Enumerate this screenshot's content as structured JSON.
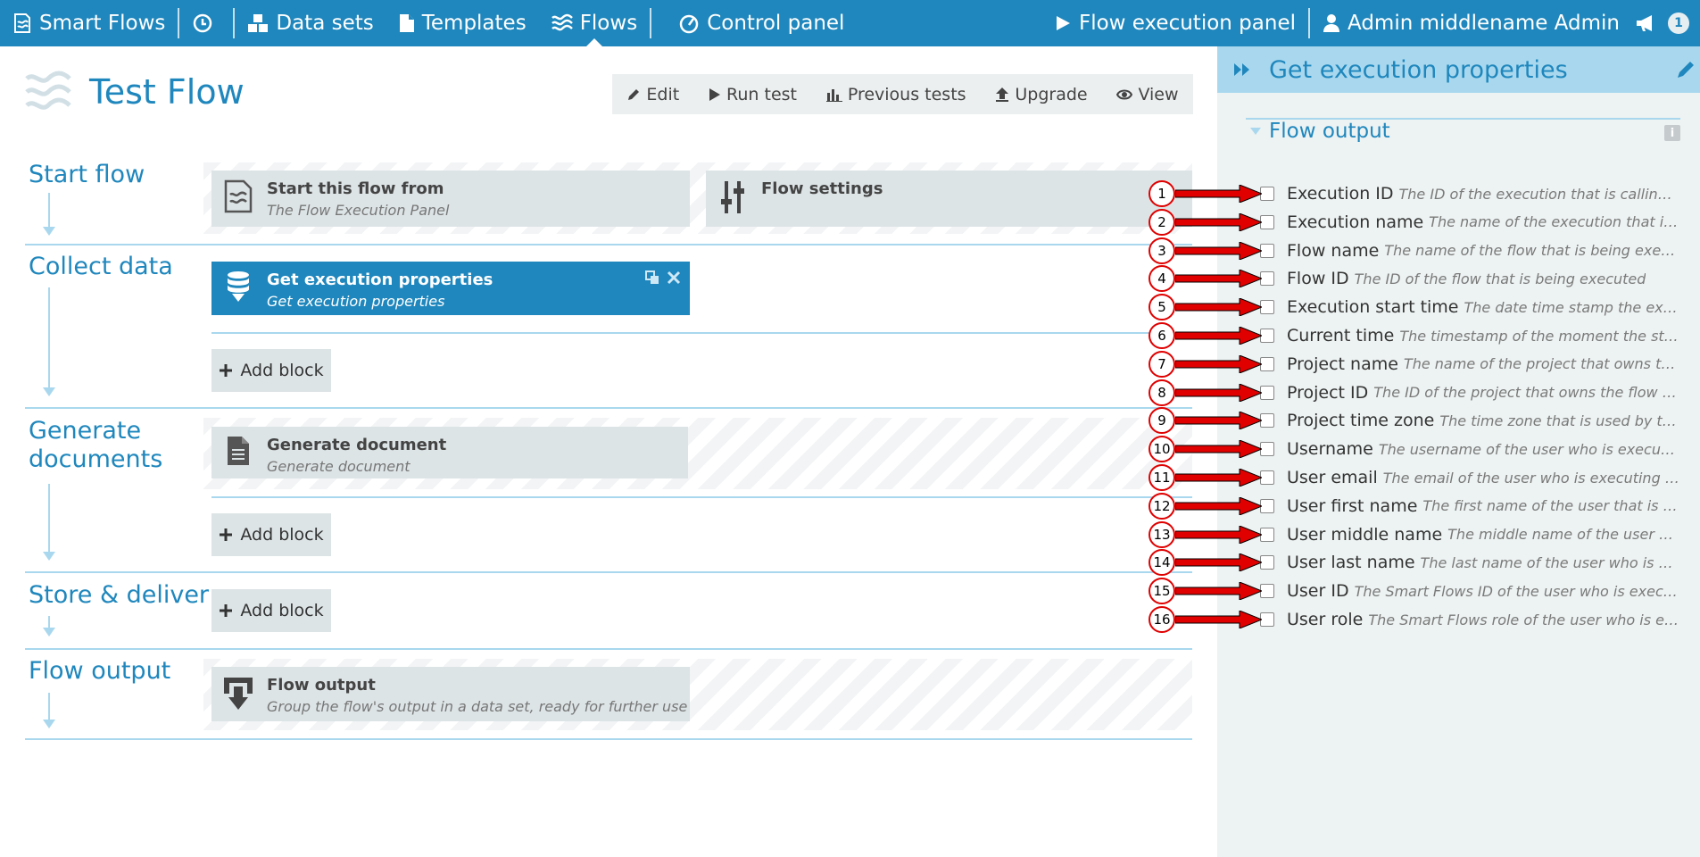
{
  "nav": {
    "brand": "Smart Flows",
    "datasets": "Data sets",
    "templates": "Templates",
    "flows": "Flows",
    "control_panel": "Control panel",
    "flow_execution_panel": "Flow execution panel",
    "user": "Admin middlename Admin",
    "notification_count": "1"
  },
  "page": {
    "title": "Test Flow"
  },
  "toolbar": {
    "edit": "Edit",
    "run_test": "Run test",
    "previous_tests": "Previous tests",
    "upgrade": "Upgrade",
    "view": "View"
  },
  "sections": {
    "start": "Start flow",
    "collect": "Collect data",
    "generate_1": "Generate",
    "generate_2": "documents",
    "store": "Store & deliver",
    "output": "Flow output"
  },
  "blocks": {
    "start_title": "Start this flow from",
    "start_sub": "The Flow Execution Panel",
    "settings_title": "Flow settings",
    "exec_title": "Get execution properties",
    "exec_sub": "Get execution properties",
    "gen_title": "Generate document",
    "gen_sub": "Generate document",
    "out_title": "Flow output",
    "out_sub": "Group the flow's output in a data set, ready for further use",
    "add_block": "Add block"
  },
  "panel": {
    "title": "Get execution properties",
    "section_title": "Flow output",
    "properties": [
      {
        "num": "1",
        "name": "Execution ID",
        "desc": "The ID of the execution that is calling th..."
      },
      {
        "num": "2",
        "name": "Execution name",
        "desc": "The name of the execution that is c..."
      },
      {
        "num": "3",
        "name": "Flow name",
        "desc": "The name of the flow that is being execut..."
      },
      {
        "num": "4",
        "name": "Flow ID",
        "desc": "The ID of the flow that is being executed"
      },
      {
        "num": "5",
        "name": "Execution start time",
        "desc": "The date time stamp the execut..."
      },
      {
        "num": "6",
        "name": "Current time",
        "desc": "The timestamp of the moment the step ..."
      },
      {
        "num": "7",
        "name": "Project name",
        "desc": "The name of the project that owns the ..."
      },
      {
        "num": "8",
        "name": "Project ID",
        "desc": "The ID of the project that owns the flow th..."
      },
      {
        "num": "9",
        "name": "Project time zone",
        "desc": "The time zone that is used by the ..."
      },
      {
        "num": "10",
        "name": "Username",
        "desc": "The username of the user who is executin..."
      },
      {
        "num": "11",
        "name": "User email",
        "desc": "The email of the user who is executing th..."
      },
      {
        "num": "12",
        "name": "User first name",
        "desc": "The first name of the user that is exe..."
      },
      {
        "num": "13",
        "name": "User middle name",
        "desc": "The middle name of the user who..."
      },
      {
        "num": "14",
        "name": "User last name",
        "desc": "The last name of the user who is exe..."
      },
      {
        "num": "15",
        "name": "User ID",
        "desc": "The Smart Flows ID of the user who is executi..."
      },
      {
        "num": "16",
        "name": "User role",
        "desc": "The Smart Flows role of the user who is exe..."
      }
    ]
  }
}
